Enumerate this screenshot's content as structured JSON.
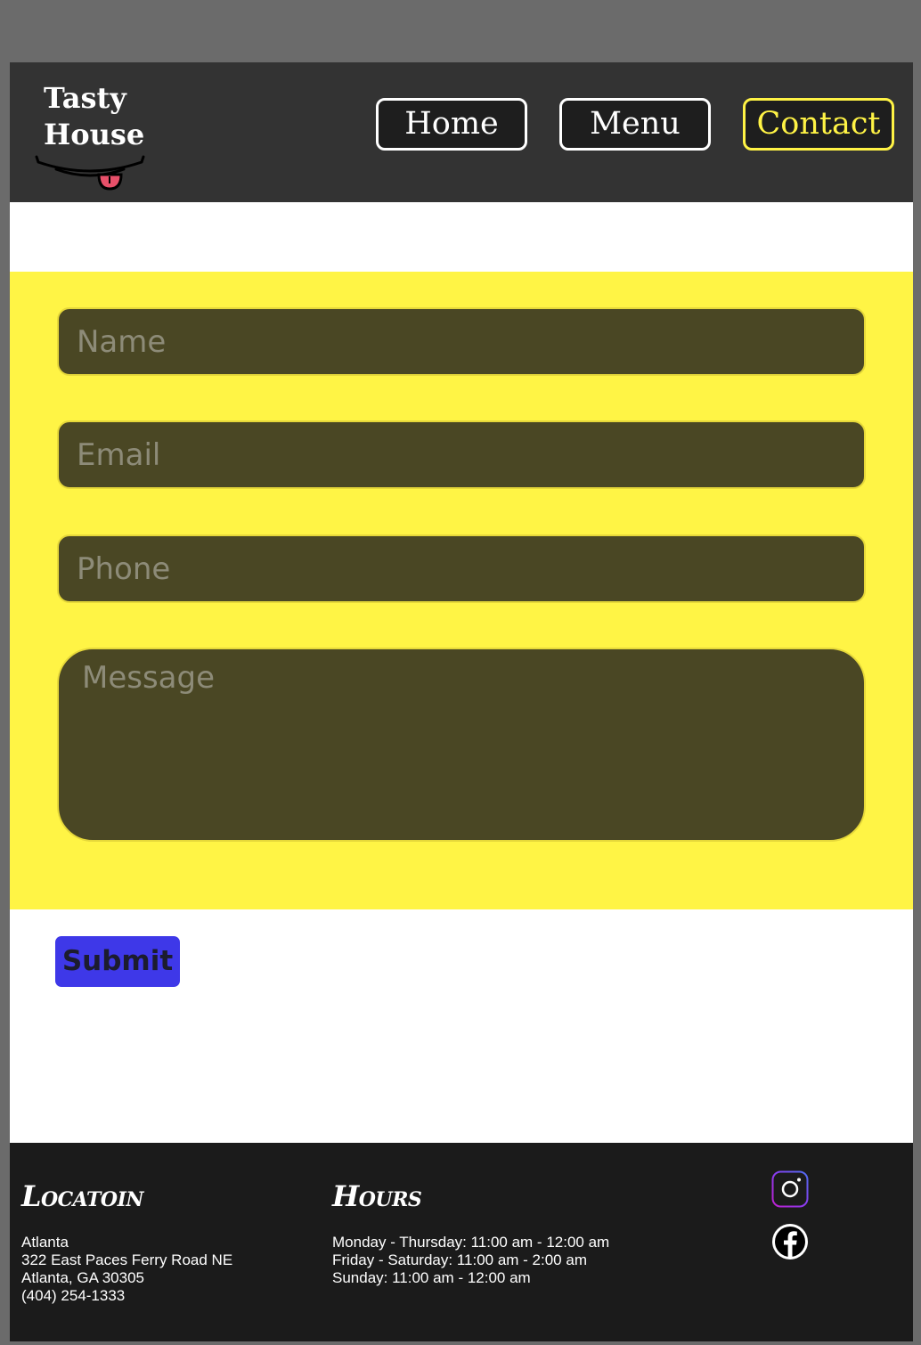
{
  "header": {
    "logo_line1": "Tasty",
    "logo_line2": "House",
    "nav": [
      {
        "label": "Home"
      },
      {
        "label": "Menu"
      },
      {
        "label": "Contact"
      }
    ]
  },
  "form": {
    "name_placeholder": "Name",
    "email_placeholder": "Email",
    "phone_placeholder": "Phone",
    "message_placeholder": "Message",
    "submit_label": "Submit"
  },
  "footer": {
    "location_heading": "Locatoin",
    "location_lines": [
      "Atlanta",
      "322 East Paces Ferry Road NE",
      "Atlanta, GA 30305",
      "(404) 254-1333"
    ],
    "hours_heading": "Hours",
    "hours_lines": [
      "Monday - Thursday: 11:00 am - 12:00 am",
      "Friday - Saturday: 11:00 am - 2:00 am",
      "Sunday: 11:00 am - 12:00 am"
    ],
    "social_icons": [
      "instagram-icon",
      "facebook-icon"
    ]
  },
  "colors": {
    "header_bg": "#333333",
    "accent_yellow": "#fff345",
    "field_bg": "#4a4724",
    "submit_bg": "#3e38e8",
    "footer_bg": "#1b1b1b"
  }
}
